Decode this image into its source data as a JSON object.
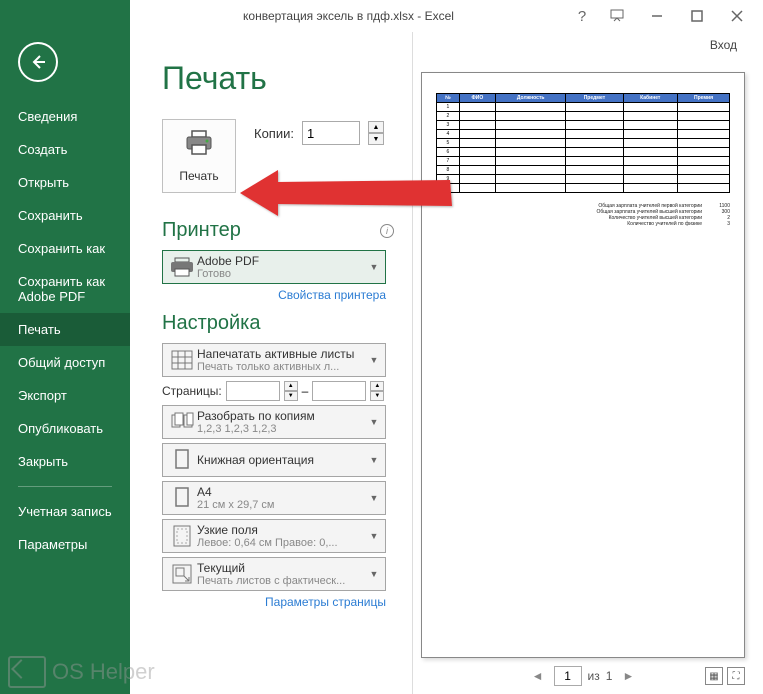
{
  "titlebar": {
    "title": "конвертация эксель в пдф.xlsx - Excel",
    "signin": "Вход"
  },
  "sidebar": {
    "items": [
      "Сведения",
      "Создать",
      "Открыть",
      "Сохранить",
      "Сохранить как",
      "Сохранить как Adobe PDF",
      "Печать",
      "Общий доступ",
      "Экспорт",
      "Опубликовать",
      "Закрыть"
    ],
    "items2": [
      "Учетная запись",
      "Параметры"
    ],
    "active_index": 6
  },
  "print": {
    "heading": "Печать",
    "button_label": "Печать",
    "copies_label": "Копии:",
    "copies_value": "1"
  },
  "printer": {
    "heading": "Принтер",
    "name": "Adobe PDF",
    "status": "Готово",
    "props_link": "Свойства принтера"
  },
  "settings": {
    "heading": "Настройка",
    "print_what": {
      "title": "Напечатать активные листы",
      "sub": "Печать только активных л..."
    },
    "pages_label": "Страницы:",
    "pages_sep": "–",
    "collate": {
      "title": "Разобрать по копиям",
      "sub": "1,2,3   1,2,3   1,2,3"
    },
    "orientation": {
      "title": "Книжная ориентация",
      "sub": ""
    },
    "size": {
      "title": "A4",
      "sub": "21 см x 29,7 см"
    },
    "margins": {
      "title": "Узкие поля",
      "sub": "Левое:  0,64 см   Правое:  0,..."
    },
    "scaling": {
      "title": "Текущий",
      "sub": "Печать листов с фактическ..."
    },
    "page_setup_link": "Параметры страницы"
  },
  "preview": {
    "page_current": "1",
    "page_sep": "из",
    "page_total": "1",
    "table_headers": [
      "№",
      "ФИО",
      "Должность",
      "Предмет",
      "Кабинет",
      "Премия"
    ],
    "table_rows": [
      [
        "1",
        "",
        "",
        "",
        "",
        ""
      ],
      [
        "2",
        "",
        "",
        "",
        "",
        ""
      ],
      [
        "3",
        "",
        "",
        "",
        "",
        ""
      ],
      [
        "4",
        "",
        "",
        "",
        "",
        ""
      ],
      [
        "5",
        "",
        "",
        "",
        "",
        ""
      ],
      [
        "6",
        "",
        "",
        "",
        "",
        ""
      ],
      [
        "7",
        "",
        "",
        "",
        "",
        ""
      ],
      [
        "8",
        "",
        "",
        "",
        "",
        ""
      ],
      [
        "9",
        "",
        "",
        "",
        "",
        ""
      ],
      [
        "10",
        "",
        "",
        "",
        "",
        ""
      ]
    ],
    "summary": [
      {
        "label": "Общая зарплата учителей первой категории",
        "value": "1100"
      },
      {
        "label": "Общая зарплата учителей высшей категории",
        "value": "300"
      },
      {
        "label": "Количество учителей высшей категории",
        "value": "2"
      },
      {
        "label": "Количество учителей по физике",
        "value": "3"
      }
    ]
  },
  "watermark": "OS Helper"
}
